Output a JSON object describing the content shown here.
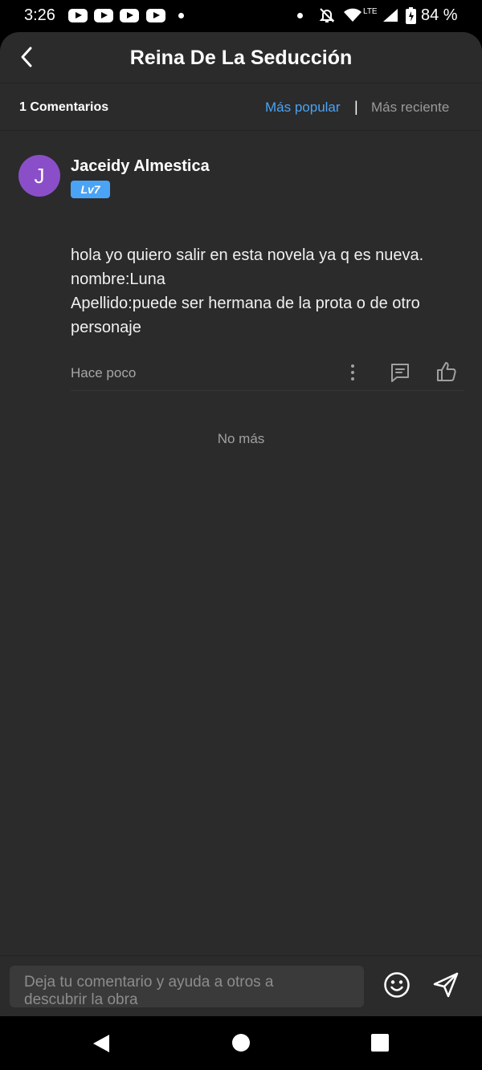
{
  "status_bar": {
    "time": "3:26",
    "network": "LTE",
    "battery": "84 %",
    "icons": [
      "youtube-icon",
      "youtube-icon",
      "youtube-icon",
      "youtube-icon",
      "notification-dot",
      "dot-icon",
      "alarm-off-icon",
      "wifi-icon",
      "signal-icon",
      "battery-icon"
    ]
  },
  "header": {
    "title": "Reina De La Seducción",
    "back_icon": "chevron-left-icon"
  },
  "filter": {
    "count_label": "1 Comentarios",
    "sort_popular": "Más popular",
    "separator": "|",
    "sort_recent": "Más reciente",
    "active_sort": "Más popular"
  },
  "comment": {
    "avatar_letter": "J",
    "author": "Jaceidy Almestica",
    "level": "Lv7",
    "lines": [
      "hola yo quiero salir en esta novela ya q es nueva.",
      "nombre:Luna",
      "Apellido:puede ser hermana de la prota o de otro",
      "personaje"
    ],
    "time": "Hace poco",
    "actions": [
      "more-vertical-icon",
      "reply-icon",
      "thumbs-up-icon"
    ]
  },
  "footer_note": "No más",
  "input": {
    "placeholder_line1": "Deja tu comentario y ayuda a otros a",
    "placeholder_line2": "descubrir la obra",
    "emoji_icon": "smiley-icon",
    "send_icon": "send-icon"
  },
  "colors": {
    "background": "#2b2b2b",
    "accent": "#4aa3f5",
    "avatar": "#8a4fc8",
    "muted_text": "#9a9a9a"
  }
}
